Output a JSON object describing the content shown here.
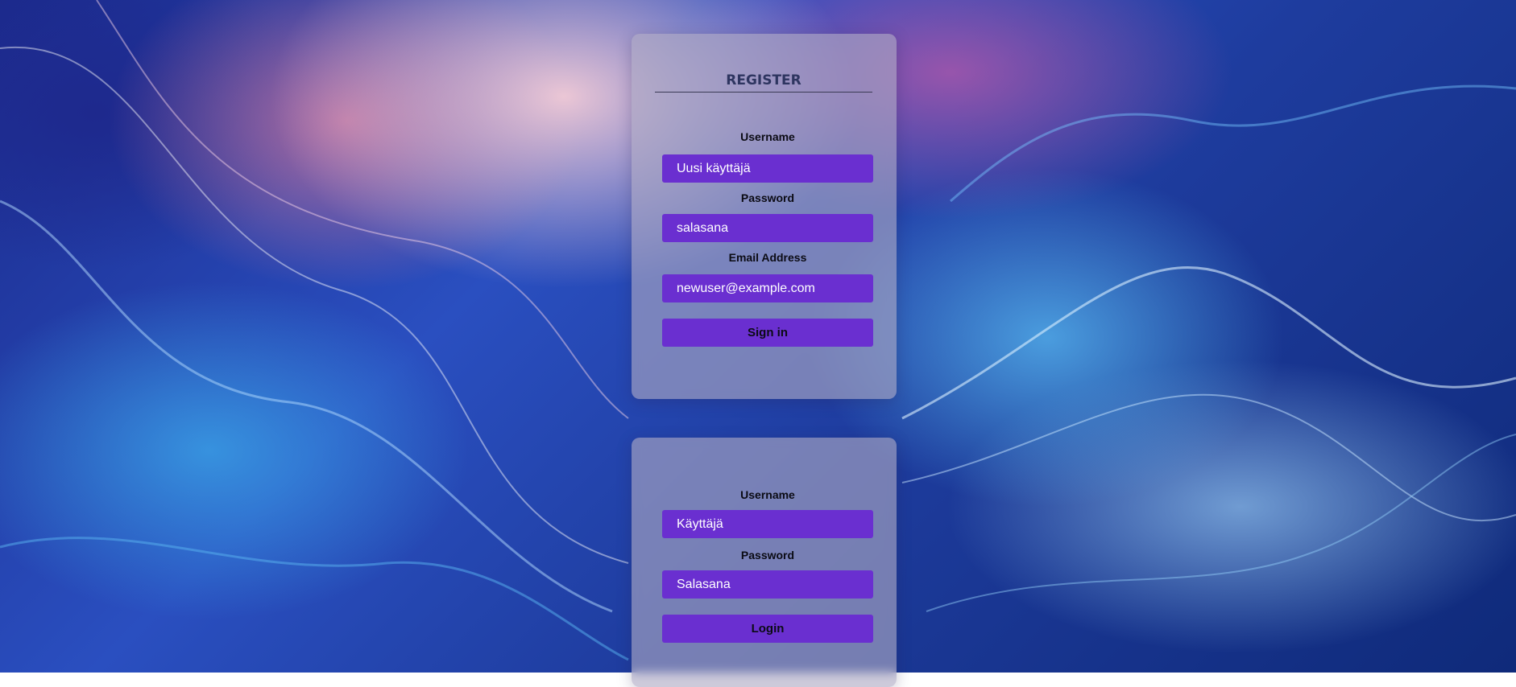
{
  "register": {
    "title": "REGISTER",
    "username_label": "Username",
    "username_value": "Uusi käyttäjä",
    "password_label": "Password",
    "password_value": "salasana",
    "email_label": "Email Address",
    "email_value": "newuser@example.com",
    "submit_label": "Sign in"
  },
  "login": {
    "username_label": "Username",
    "username_value": "Käyttäjä",
    "password_label": "Password",
    "password_value": "Salasana",
    "submit_label": "Login"
  },
  "colors": {
    "input_bg": "#6a2fd0",
    "card_bg": "rgba(175,170,195,0.62)",
    "title_color": "#2e3560"
  }
}
